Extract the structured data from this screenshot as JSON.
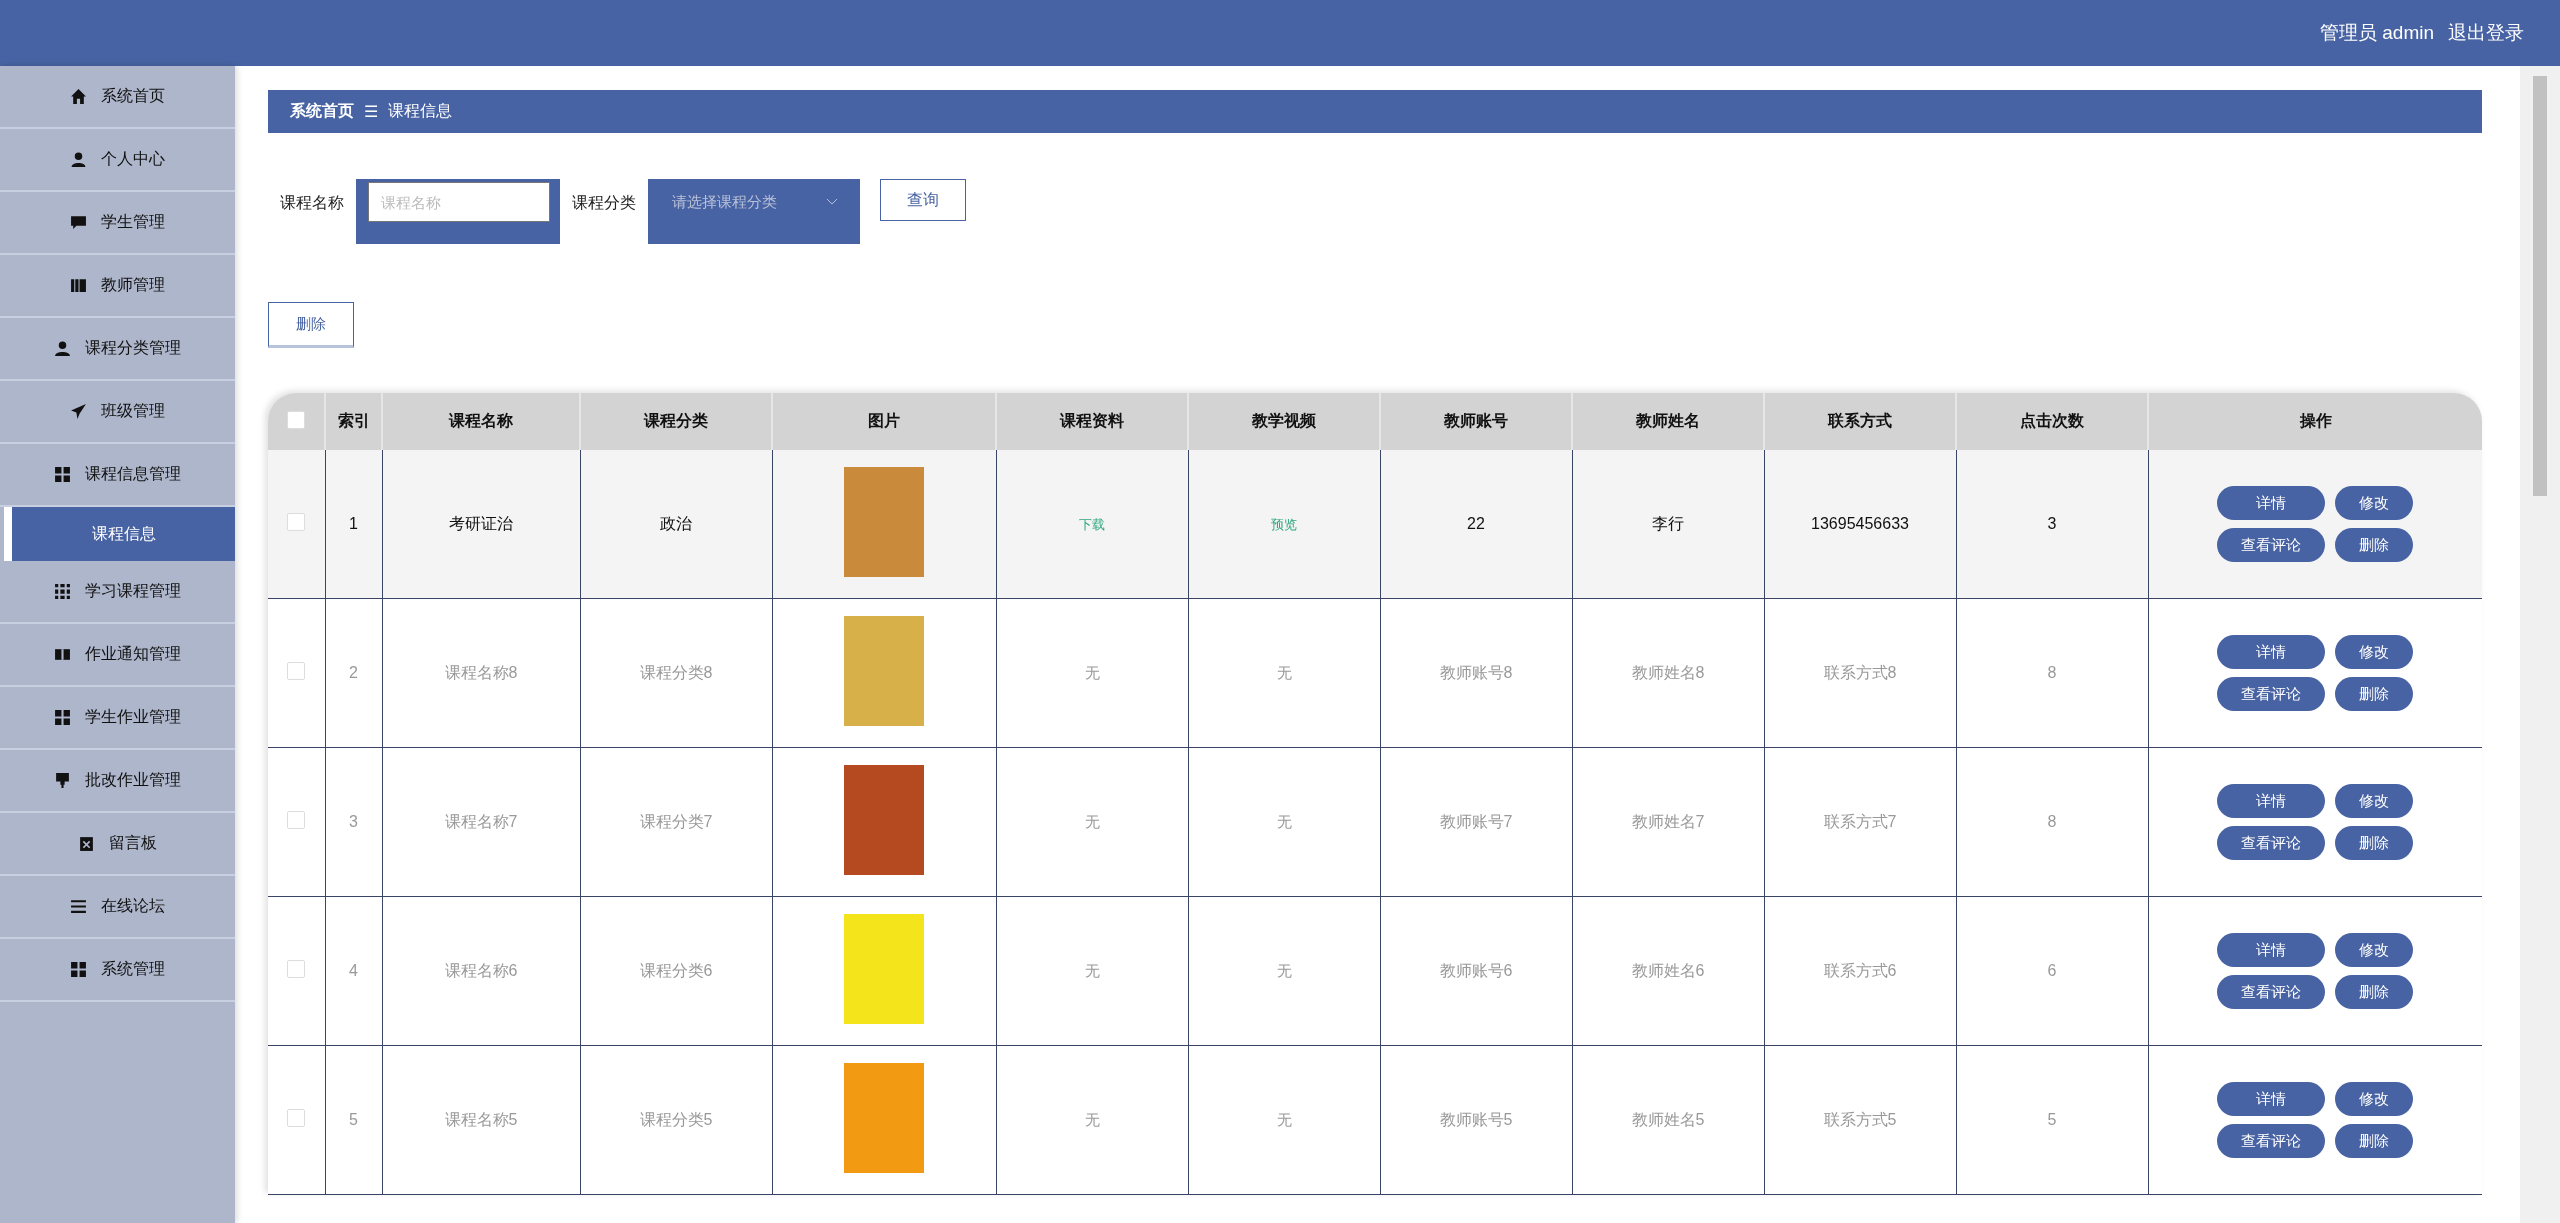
{
  "header": {
    "user": "管理员 admin",
    "logout": "退出登录"
  },
  "sidebar": {
    "items": [
      {
        "label": "系统首页",
        "selected": false
      },
      {
        "label": "个人中心",
        "selected": false
      },
      {
        "label": "学生管理",
        "selected": false
      },
      {
        "label": "教师管理",
        "selected": false
      },
      {
        "label": "课程分类管理",
        "selected": false
      },
      {
        "label": "班级管理",
        "selected": false
      },
      {
        "label": "课程信息管理",
        "selected": false,
        "children": [
          {
            "label": "课程信息",
            "selected": true
          }
        ]
      },
      {
        "label": "学习课程管理",
        "selected": false
      },
      {
        "label": "作业通知管理",
        "selected": false
      },
      {
        "label": "学生作业管理",
        "selected": false
      },
      {
        "label": "批改作业管理",
        "selected": false
      },
      {
        "label": "留言板",
        "selected": false
      },
      {
        "label": "在线论坛",
        "selected": false
      },
      {
        "label": "系统管理",
        "selected": false
      }
    ]
  },
  "breadcrumb": {
    "home": "系统首页",
    "separator": "☰",
    "current": "课程信息"
  },
  "search": {
    "name_label": "课程名称",
    "name_placeholder": "课程名称",
    "category_label": "课程分类",
    "category_placeholder": "请选择课程分类",
    "query_button": "查询"
  },
  "delete_button": "删除",
  "table": {
    "select_all_checked": false,
    "columns": [
      "索引",
      "课程名称",
      "课程分类",
      "图片",
      "课程资料",
      "教学视频",
      "教师账号",
      "教师姓名",
      "联系方式",
      "点击次数",
      "操作"
    ],
    "rows": [
      {
        "checked": false,
        "highlighted": true,
        "index": "1",
        "name": "考研证治",
        "category": "政治",
        "material": {
          "kind": "link",
          "text": "下载"
        },
        "video": {
          "kind": "link",
          "text": "预览"
        },
        "teacher_account": "22",
        "teacher_name": "李行",
        "contact": "13695456633",
        "clicks": "3",
        "actions": [
          "详情",
          "修改",
          "查看评论",
          "删除"
        ]
      },
      {
        "checked": false,
        "highlighted": false,
        "index": "2",
        "name": "课程名称8",
        "category": "课程分类8",
        "material": {
          "kind": "none",
          "text": "无"
        },
        "video": {
          "kind": "none",
          "text": "无"
        },
        "teacher_account": "教师账号8",
        "teacher_name": "教师姓名8",
        "contact": "联系方式8",
        "clicks": "8",
        "actions": [
          "详情",
          "修改",
          "查看评论",
          "删除"
        ]
      },
      {
        "checked": false,
        "highlighted": false,
        "index": "3",
        "name": "课程名称7",
        "category": "课程分类7",
        "material": {
          "kind": "none",
          "text": "无"
        },
        "video": {
          "kind": "none",
          "text": "无"
        },
        "teacher_account": "教师账号7",
        "teacher_name": "教师姓名7",
        "contact": "联系方式7",
        "clicks": "8",
        "actions": [
          "详情",
          "修改",
          "查看评论",
          "删除"
        ]
      },
      {
        "checked": false,
        "highlighted": false,
        "index": "4",
        "name": "课程名称6",
        "category": "课程分类6",
        "material": {
          "kind": "none",
          "text": "无"
        },
        "video": {
          "kind": "none",
          "text": "无"
        },
        "teacher_account": "教师账号6",
        "teacher_name": "教师姓名6",
        "contact": "联系方式6",
        "clicks": "6",
        "actions": [
          "详情",
          "修改",
          "查看评论",
          "删除"
        ]
      },
      {
        "checked": false,
        "highlighted": false,
        "index": "5",
        "name": "课程名称5",
        "category": "课程分类5",
        "material": {
          "kind": "none",
          "text": "无"
        },
        "video": {
          "kind": "none",
          "text": "无"
        },
        "teacher_account": "教师账号5",
        "teacher_name": "教师姓名5",
        "contact": "联系方式5",
        "clicks": "5",
        "actions": [
          "详情",
          "修改",
          "查看评论",
          "删除"
        ]
      }
    ]
  }
}
